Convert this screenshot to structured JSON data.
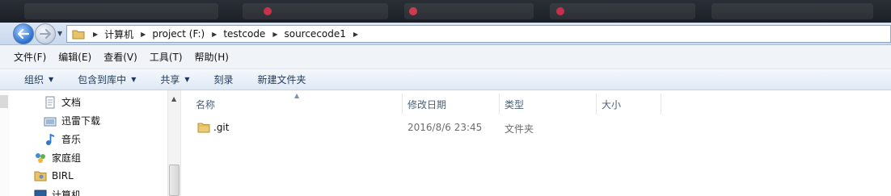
{
  "address_bar": {
    "breadcrumbs": [
      "计算机",
      "project (F:)",
      "testcode",
      "sourcecode1"
    ]
  },
  "menu": [
    "文件(F)",
    "编辑(E)",
    "查看(V)",
    "工具(T)",
    "帮助(H)"
  ],
  "toolbar": {
    "organize": "组织",
    "include_in_library": "包含到库中",
    "share": "共享",
    "burn": "刻录",
    "new_folder": "新建文件夹"
  },
  "nav": {
    "items": [
      {
        "label": "文档",
        "icon": "document-icon"
      },
      {
        "label": "迅雷下载",
        "icon": "download-folder-icon"
      },
      {
        "label": "音乐",
        "icon": "music-icon"
      },
      {
        "label": "家庭组",
        "icon": "homegroup-icon"
      },
      {
        "label": "BIRL",
        "icon": "user-folder-icon"
      },
      {
        "label": "计算机",
        "icon": "computer-icon"
      }
    ]
  },
  "columns": {
    "name": "名称",
    "date": "修改日期",
    "type": "类型",
    "size": "大小"
  },
  "files": [
    {
      "name": ".git",
      "date": "2016/8/6 23:45",
      "type": "文件夹",
      "size": ""
    }
  ]
}
